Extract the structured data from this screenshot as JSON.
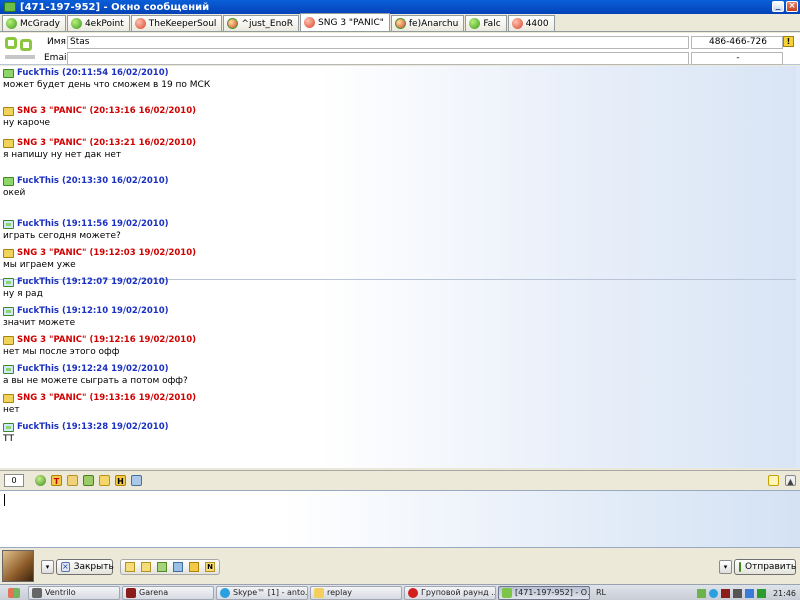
{
  "window": {
    "title": "[471-197-952] - Окно сообщений",
    "minimize": "_",
    "maximize": "□",
    "close": "×"
  },
  "tabs": [
    {
      "label": "McGrady",
      "icon": "green"
    },
    {
      "label": "4ekPoint",
      "icon": "green"
    },
    {
      "label": "TheKeeperSoul",
      "icon": "red"
    },
    {
      "label": "^just_EnoR",
      "icon": "mixed"
    },
    {
      "label": "SNG 3 \"PANIC\"",
      "icon": "red",
      "active": true
    },
    {
      "label": "fe)Anarchu",
      "icon": "mixed"
    },
    {
      "label": "Falc",
      "icon": "green"
    },
    {
      "label": "4400",
      "icon": "red"
    }
  ],
  "contact": {
    "name_label": "Имя:",
    "name_value": "Stas",
    "email_label": "Email:",
    "email_value": "",
    "uin": "486-466-726",
    "uin2": "-",
    "info_icon": "!"
  },
  "messages": [
    {
      "author": "FuckThis",
      "time": "(20:11:54 16/02/2010)",
      "text": "может будет день что сможем в 19 по МСК",
      "color": "blue",
      "icon": "green"
    },
    {
      "author": "SNG 3 \"PANIC\"",
      "time": "(20:13:16 16/02/2010)",
      "text": "ну кароче",
      "color": "red",
      "icon": "yellow"
    },
    {
      "author": "SNG 3 \"PANIC\"",
      "time": "(20:13:21 16/02/2010)",
      "text": "я напишу ну нет дак нет",
      "color": "red",
      "icon": "yellow"
    },
    {
      "author": "FuckThis",
      "time": "(20:13:30 16/02/2010)",
      "text": "окей",
      "color": "blue",
      "icon": "green"
    },
    {
      "author": "FuckThis",
      "time": "(19:11:56 19/02/2010)",
      "text": "играть сегодня можете?",
      "color": "blue",
      "icon": "greenbox"
    },
    {
      "author": "SNG 3 \"PANIC\"",
      "time": "(19:12:03 19/02/2010)",
      "text": "мы играем уже",
      "color": "red",
      "icon": "yellow"
    },
    {
      "author": "FuckThis",
      "time": "(19:12:07 19/02/2010)",
      "text": "ну я рад",
      "color": "blue",
      "icon": "greenbox"
    },
    {
      "author": "FuckThis",
      "time": "(19:12:10 19/02/2010)",
      "text": "значит можете",
      "color": "blue",
      "icon": "greenbox"
    },
    {
      "author": "SNG 3 \"PANIC\"",
      "time": "(19:12:16 19/02/2010)",
      "text": "нет мы после этого офф",
      "color": "red",
      "icon": "yellow"
    },
    {
      "author": "FuckThis",
      "time": "(19:12:24 19/02/2010)",
      "text": "а вы не можете сыграть а потом офф?",
      "color": "blue",
      "icon": "greenbox"
    },
    {
      "author": "SNG 3 \"PANIC\"",
      "time": "(19:13:16 19/02/2010)",
      "text": "нет",
      "color": "red",
      "icon": "yellow"
    },
    {
      "author": "FuckThis",
      "time": "(19:13:28 19/02/2010)",
      "text": "ТТ",
      "color": "blue",
      "icon": "greenbox"
    }
  ],
  "compose": {
    "char_count": "0",
    "input_value": ""
  },
  "buttons": {
    "close_label": "Закрыть",
    "send_label": "Отправить",
    "dropdown_glyph": "▾"
  },
  "taskbar": {
    "items": [
      {
        "label": "Ventrilo",
        "icon": "vent"
      },
      {
        "label": "Garena",
        "icon": "garena"
      },
      {
        "label": "Skype™ [1] - anto...",
        "icon": "skype"
      },
      {
        "label": "replay",
        "icon": "folder"
      },
      {
        "label": "Груповой раунд ...",
        "icon": "opera"
      },
      {
        "label": "[471-197-952] - О...",
        "icon": "qip",
        "active": true
      }
    ],
    "language": "RL",
    "clock": "21:46"
  },
  "colors": {
    "author_blue": "#1a30c0",
    "author_red": "#d00000",
    "titlebar": "#0a5fd8"
  }
}
